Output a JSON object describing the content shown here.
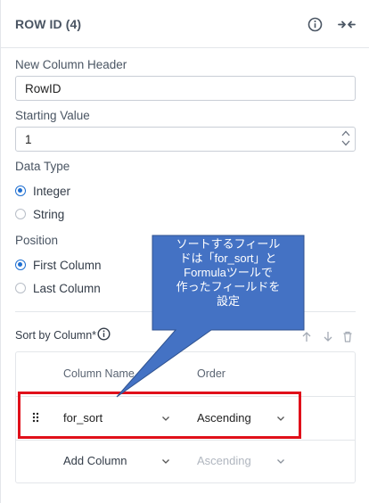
{
  "header": {
    "title": "ROW ID (4)",
    "info_icon": "info-icon",
    "collapse_icon": "collapse-arrows-icon"
  },
  "fields": {
    "column_header_label": "New Column Header",
    "column_header_value": "RowID",
    "starting_value_label": "Starting Value",
    "starting_value_value": "1",
    "data_type_label": "Data Type",
    "data_type_options": [
      {
        "label": "Integer",
        "selected": true
      },
      {
        "label": "String",
        "selected": false
      }
    ],
    "position_label": "Position",
    "position_options": [
      {
        "label": "First Column",
        "selected": true
      },
      {
        "label": "Last Column",
        "selected": false
      }
    ]
  },
  "sort": {
    "label": "Sort by Column*",
    "headers": {
      "column_name": "Column Name",
      "order": "Order"
    },
    "rows": [
      {
        "column": "for_sort",
        "order": "Ascending"
      },
      {
        "column": "Add Column",
        "order": "Ascending"
      }
    ]
  },
  "annotation": {
    "text": "ソートするフィール\nドは「for_sort」と\nFormulaツールで\n作ったフィールドを\n設定",
    "fill_color": "#4472c4",
    "highlight_color": "#e0101a"
  },
  "colors": {
    "accent": "#1f6fd1",
    "border": "#e3e6ea",
    "text": "#333c48"
  }
}
